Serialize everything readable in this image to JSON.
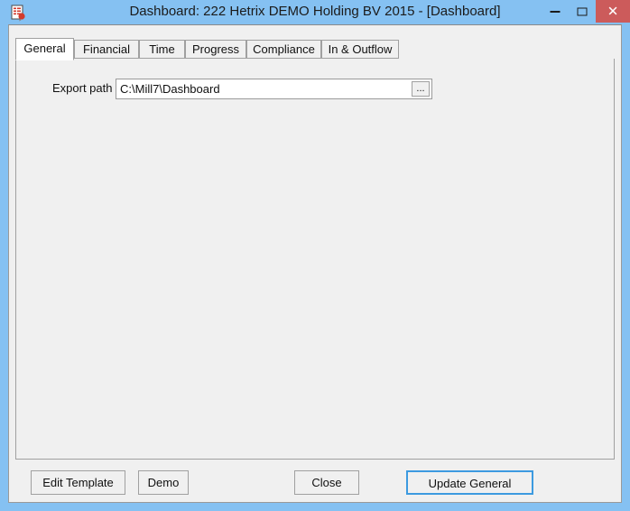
{
  "window": {
    "title": "Dashboard: 222 Hetrix DEMO Holding BV 2015 - [Dashboard]",
    "icon": "document-red-lines-icon",
    "controls": {
      "minimize": "–",
      "maximize": "□",
      "close": "✕"
    },
    "colors": {
      "title_bar": "#85c1f2",
      "close_button": "#cc5b5b",
      "client_background": "#f0f0f0",
      "accent_focus": "#3c9ae0"
    }
  },
  "tabs": [
    {
      "label": "General",
      "active": true
    },
    {
      "label": "Financial",
      "active": false
    },
    {
      "label": "Time",
      "active": false
    },
    {
      "label": "Progress",
      "active": false
    },
    {
      "label": "Compliance",
      "active": false
    },
    {
      "label": "In & Outflow",
      "active": false
    }
  ],
  "general_tab": {
    "export_path": {
      "label": "Export path",
      "value": "C:\\Mill7\\Dashboard",
      "placeholder": "",
      "browse_label": "..."
    }
  },
  "footer": {
    "edit_template_label": "Edit Template",
    "demo_label": "Demo",
    "close_label": "Close",
    "update_general_label": "Update General"
  }
}
